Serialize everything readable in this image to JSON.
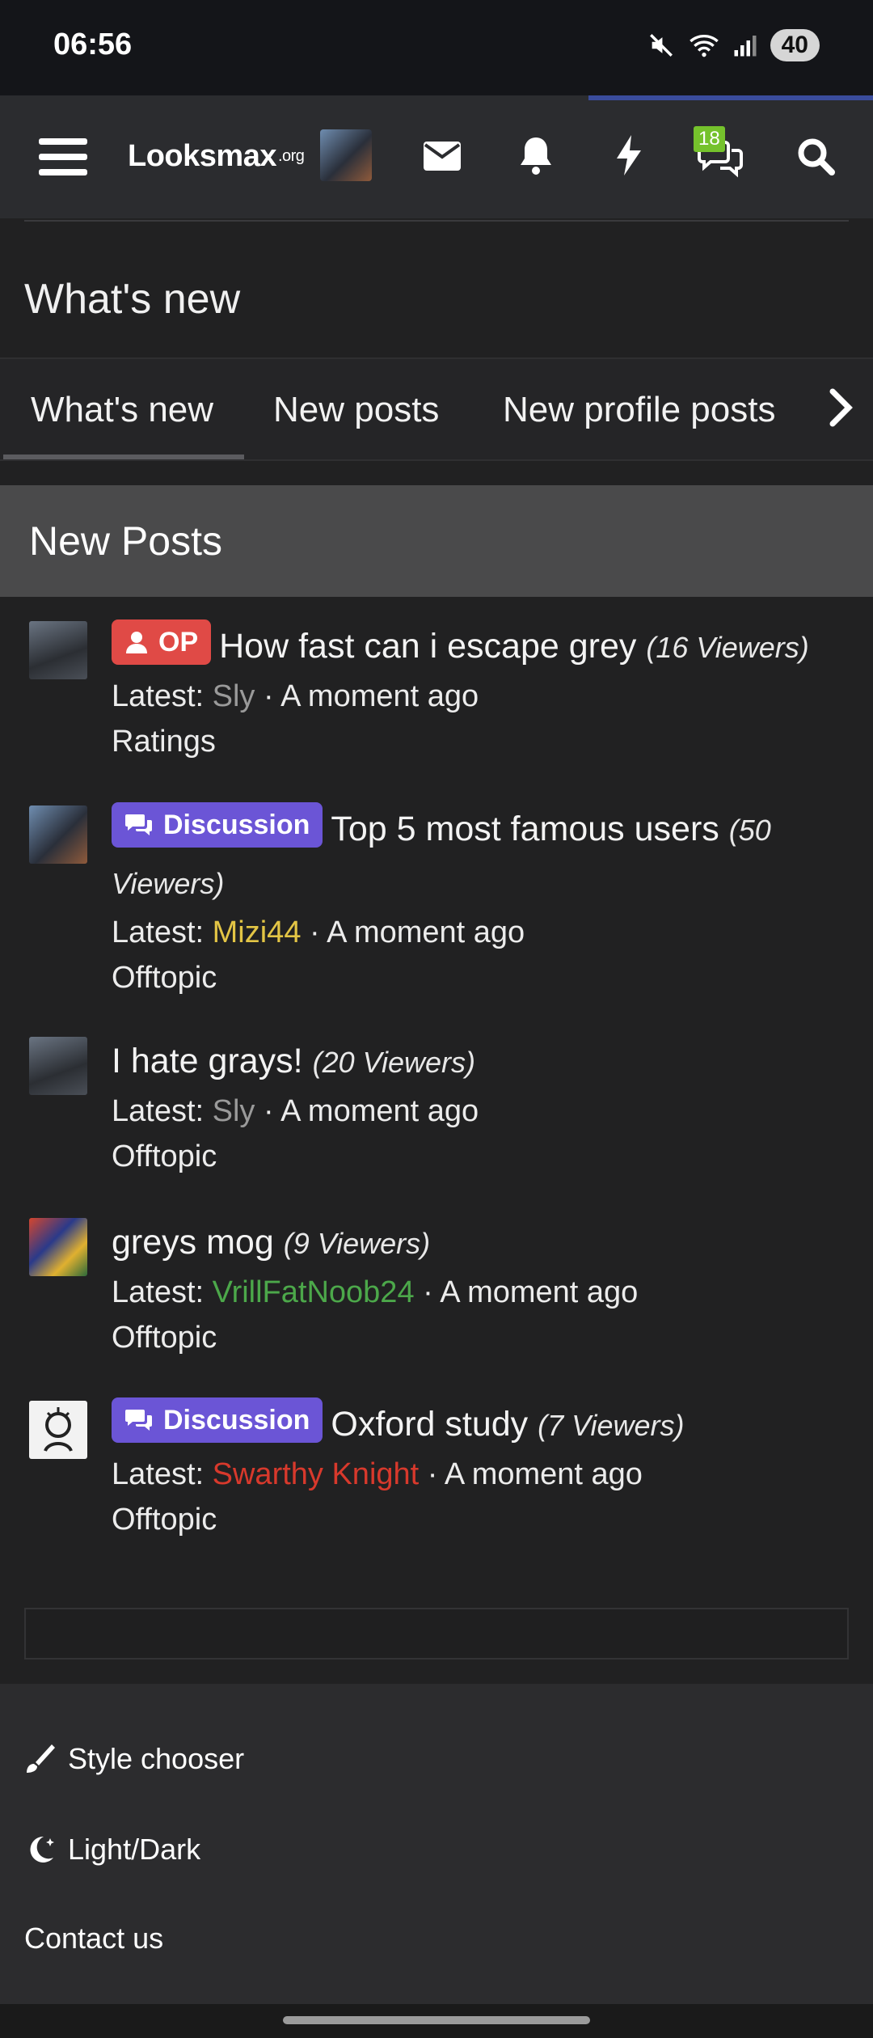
{
  "status": {
    "time": "06:56",
    "battery": "40"
  },
  "header": {
    "logo_main": "Lᴏᴏksmax",
    "logo_suffix": ".org",
    "notif_count": "18"
  },
  "page": {
    "title": "What's new"
  },
  "tabs": [
    {
      "label": "What's new"
    },
    {
      "label": "New posts"
    },
    {
      "label": "New profile posts"
    }
  ],
  "section": {
    "title": "New Posts"
  },
  "posts": [
    {
      "label": "OP",
      "title": "How fast can i escape grey",
      "viewers": "(16 Viewers)",
      "latest_prefix": "Latest:",
      "user": "Sly",
      "user_color": "#9a9a9a",
      "time": "· A moment ago",
      "forum": "Ratings"
    },
    {
      "label": "Discussion",
      "title": "Top 5 most famous users",
      "viewers": "(50 Viewers)",
      "latest_prefix": "Latest:",
      "user": "Mizi44",
      "user_color": "#e3c545",
      "time": "· A moment ago",
      "forum": "Offtopic"
    },
    {
      "label": "",
      "title": "I hate grays!",
      "viewers": "(20 Viewers)",
      "latest_prefix": "Latest:",
      "user": "Sly",
      "user_color": "#9a9a9a",
      "time": "· A moment ago",
      "forum": "Offtopic"
    },
    {
      "label": "",
      "title": "greys mog",
      "viewers": "(9 Viewers)",
      "latest_prefix": "Latest:",
      "user": "VrillFatNoob24",
      "user_color": "#4ca84a",
      "time": "· A moment ago",
      "forum": "Offtopic"
    },
    {
      "label": "Discussion",
      "title": "Oxford study",
      "viewers": "(7 Viewers)",
      "latest_prefix": "Latest:",
      "user": "Swarthy Knight",
      "user_color": "#d8392c",
      "time": "· A moment ago",
      "forum": "Offtopic"
    }
  ],
  "footer": {
    "style_chooser": "Style chooser",
    "light_dark": "Light/Dark",
    "contact": "Contact us"
  },
  "colors": {
    "accent": "#3a4c9c",
    "label_op": "#e04a46",
    "label_discussion": "#6b55d6",
    "badge": "#75c22c"
  }
}
